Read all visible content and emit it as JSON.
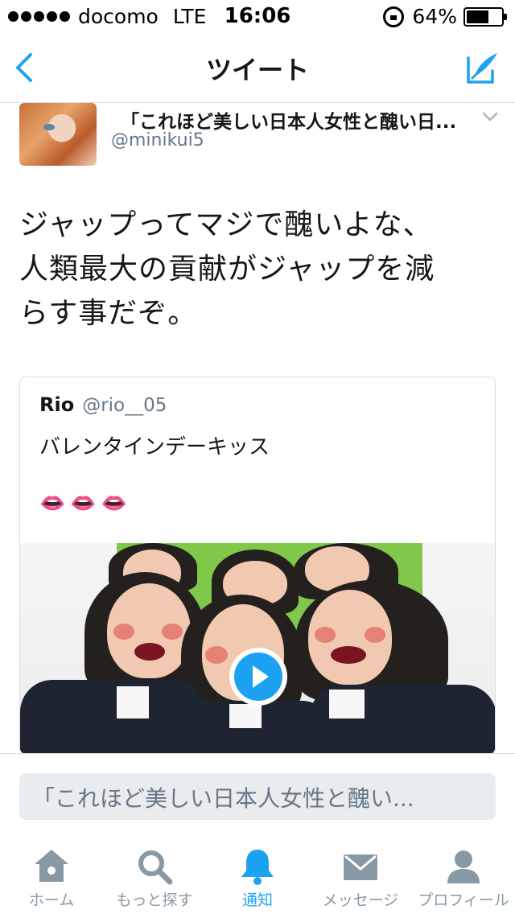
{
  "status_bar": {
    "carrier": "docomo",
    "network": "LTE",
    "time": "16:06",
    "battery": "64%",
    "battery_level": 0.64
  },
  "nav": {
    "title": "ツイート",
    "back_icon": "chevron-left-icon",
    "compose_icon": "compose-icon"
  },
  "tweet": {
    "author_name": "「これほど美しい日本人女性と醜い日...",
    "author_handle": "@minikui5",
    "text_lines": [
      "ジャップってマジで醜いよな、",
      "人類最大の貢献がジャップを減",
      "らす事だぞ。"
    ]
  },
  "quote": {
    "name": "Rio",
    "handle": "@rio__05",
    "text": "バレンタインデーキッス",
    "emoji": "👄👄👄"
  },
  "reply": {
    "placeholder": "「これほど美しい日本人女性と醜い..."
  },
  "tabs": [
    {
      "label": "ホーム",
      "icon": "home-icon",
      "active": false
    },
    {
      "label": "もっと探す",
      "icon": "search-icon",
      "active": false
    },
    {
      "label": "通知",
      "icon": "bell-icon",
      "active": true
    },
    {
      "label": "メッセージ",
      "icon": "envelope-icon",
      "active": false
    },
    {
      "label": "プロフィール",
      "icon": "person-icon",
      "active": false
    }
  ],
  "colors": {
    "accent": "#1da1f2",
    "tab_inactive": "#8899a6",
    "secondary_text": "#657786"
  }
}
